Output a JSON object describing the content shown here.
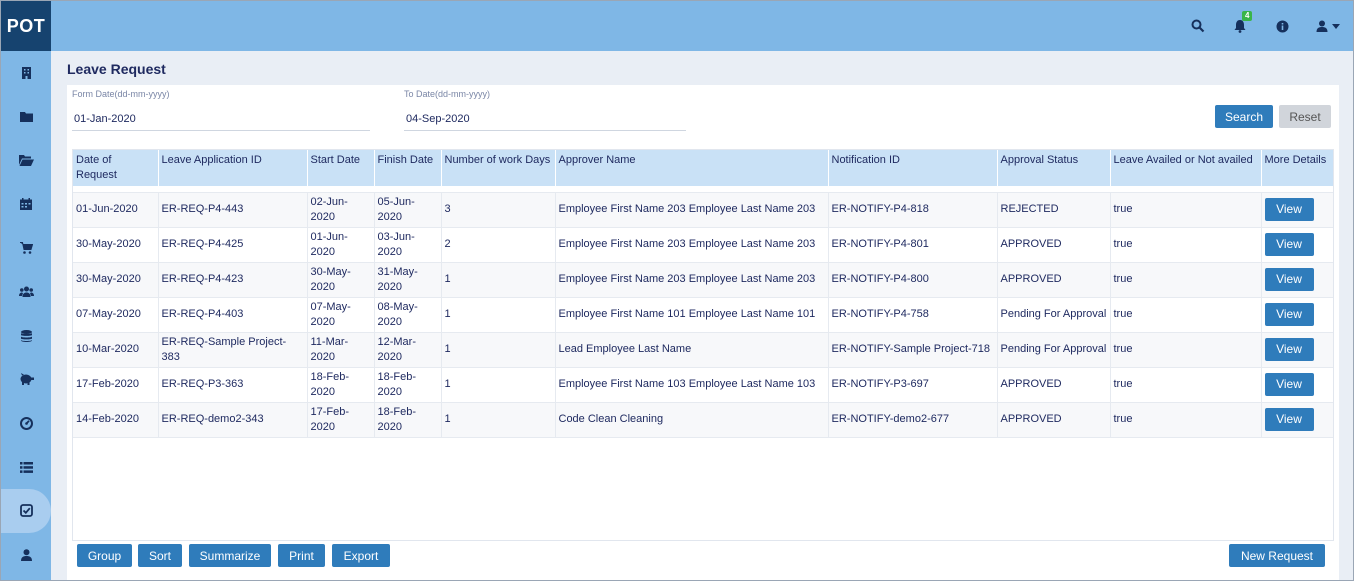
{
  "app": {
    "logo": "POT",
    "notification_count": "4"
  },
  "topbar": {
    "icons": [
      "search-icon",
      "bell-icon",
      "info-icon",
      "user-icon",
      "caret-down-icon"
    ]
  },
  "sidebar": {
    "items": [
      {
        "icon": "building-icon"
      },
      {
        "icon": "folder-icon"
      },
      {
        "icon": "folder-open-icon"
      },
      {
        "icon": "calendar-icon"
      },
      {
        "icon": "cart-icon"
      },
      {
        "icon": "users-icon"
      },
      {
        "icon": "database-icon"
      },
      {
        "icon": "piggy-bank-icon"
      },
      {
        "icon": "dashboard-icon"
      },
      {
        "icon": "list-icon"
      },
      {
        "icon": "check-square-icon",
        "active": true
      },
      {
        "icon": "user-icon"
      }
    ]
  },
  "page": {
    "title": "Leave Request"
  },
  "filters": {
    "from_label": "Form Date(dd-mm-yyyy)",
    "from_value": "01-Jan-2020",
    "to_label": "To Date(dd-mm-yyyy)",
    "to_value": "04-Sep-2020",
    "search_label": "Search",
    "reset_label": "Reset"
  },
  "table": {
    "headers": [
      "Date of Request",
      "Leave Application ID",
      "Start Date",
      "Finish Date",
      "Number of work Days",
      "Approver Name",
      "Notification ID",
      "Approval Status",
      "Leave Availed or Not availed",
      "More Details"
    ],
    "rows": [
      [
        "01-Jun-2020",
        "ER-REQ-P4-443",
        "02-Jun-2020",
        "05-Jun-2020",
        "3",
        "Employee First Name 203 Employee Last Name 203",
        "ER-NOTIFY-P4-818",
        "REJECTED",
        "true",
        "View"
      ],
      [
        "30-May-2020",
        "ER-REQ-P4-425",
        "01-Jun-2020",
        "03-Jun-2020",
        "2",
        "Employee First Name 203 Employee Last Name 203",
        "ER-NOTIFY-P4-801",
        "APPROVED",
        "true",
        "View"
      ],
      [
        "30-May-2020",
        "ER-REQ-P4-423",
        "30-May-2020",
        "31-May-2020",
        "1",
        "Employee First Name 203 Employee Last Name 203",
        "ER-NOTIFY-P4-800",
        "APPROVED",
        "true",
        "View"
      ],
      [
        "07-May-2020",
        "ER-REQ-P4-403",
        "07-May-2020",
        "08-May-2020",
        "1",
        "Employee First Name 101 Employee Last Name 101",
        "ER-NOTIFY-P4-758",
        "Pending For Approval",
        "true",
        "View"
      ],
      [
        "10-Mar-2020",
        "ER-REQ-Sample Project-383",
        "11-Mar-2020",
        "12-Mar-2020",
        "1",
        "Lead Employee Last Name",
        "ER-NOTIFY-Sample Project-718",
        "Pending For Approval",
        "true",
        "View"
      ],
      [
        "17-Feb-2020",
        "ER-REQ-P3-363",
        "18-Feb-2020",
        "18-Feb-2020",
        "1",
        "Employee First Name 103 Employee Last Name 103",
        "ER-NOTIFY-P3-697",
        "APPROVED",
        "true",
        "View"
      ],
      [
        "14-Feb-2020",
        "ER-REQ-demo2-343",
        "17-Feb-2020",
        "18-Feb-2020",
        "1",
        "Code Clean Cleaning",
        "ER-NOTIFY-demo2-677",
        "APPROVED",
        "true",
        "View"
      ]
    ]
  },
  "footer": {
    "buttons": [
      "Group",
      "Sort",
      "Summarize",
      "Print",
      "Export"
    ],
    "new_request_label": "New Request"
  }
}
